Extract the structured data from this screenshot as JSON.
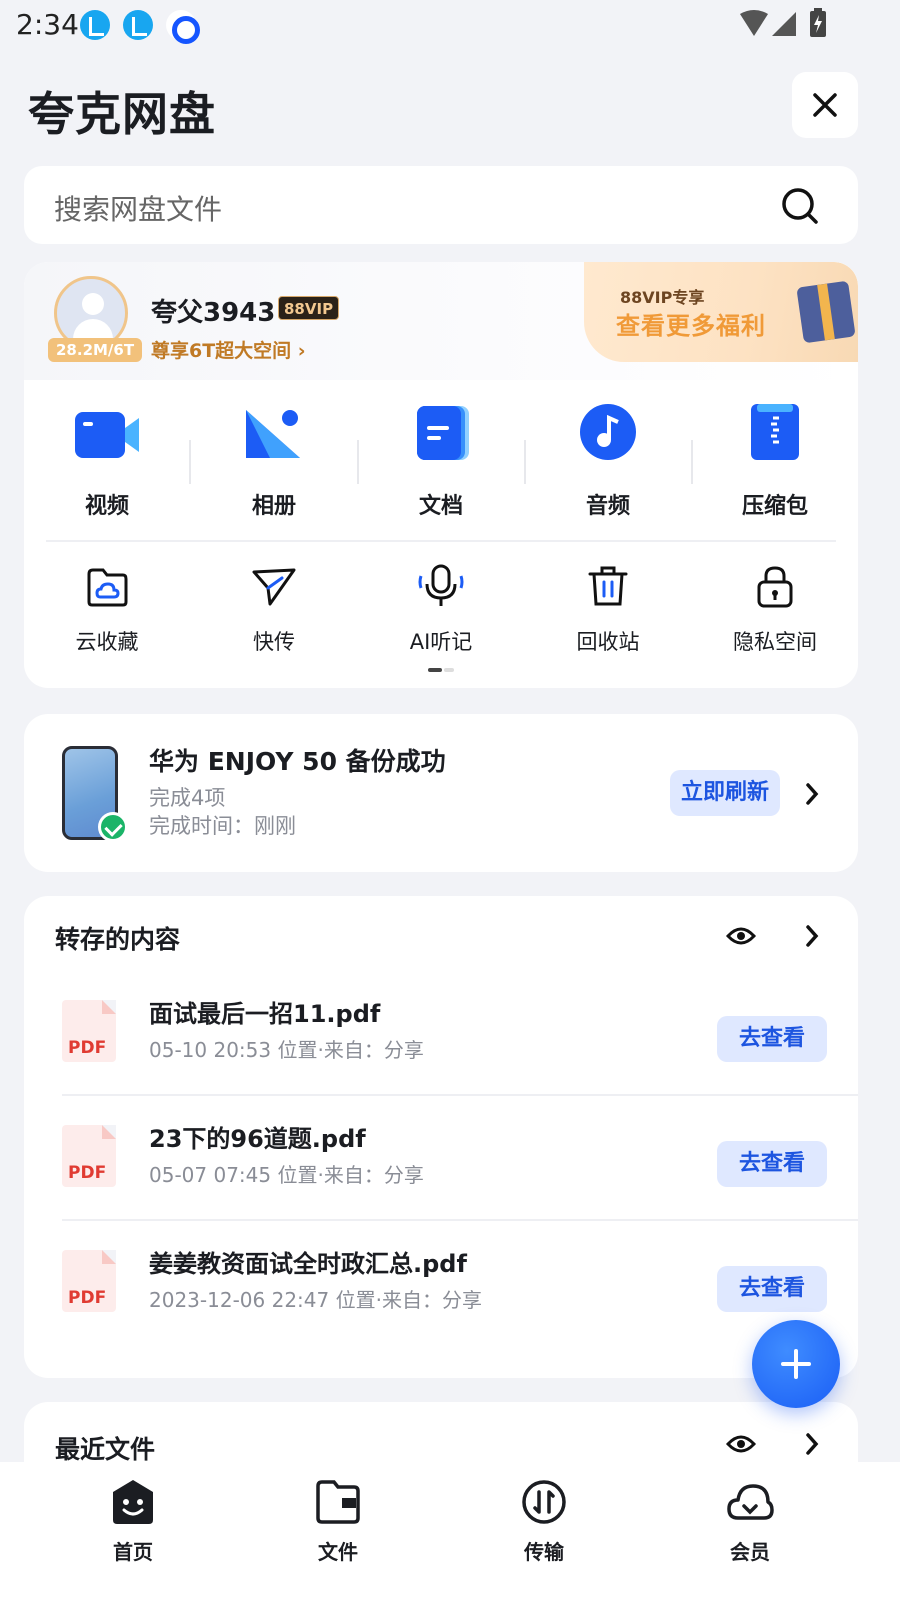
{
  "status_bar": {
    "time": "2:34",
    "icons": [
      "download-icon",
      "download-icon",
      "app-ring-icon",
      "wifi-icon",
      "cell-signal-icon",
      "battery-charging-icon"
    ]
  },
  "header": {
    "title": "夸克网盘",
    "close_icon": "close-icon"
  },
  "search": {
    "placeholder": "搜索网盘文件",
    "icon": "search-icon"
  },
  "profile": {
    "nickname": "夸父3943",
    "vip_badge": "88VIP",
    "storage": "28.2M/6T",
    "upgrade_text": "尊享6T超大空间",
    "promo": {
      "line1": "88VIP专享",
      "line2": "查看更多福利"
    }
  },
  "categories": [
    {
      "label": "视频",
      "icon": "video-icon",
      "color": "#1c5cf5"
    },
    {
      "label": "相册",
      "icon": "album-icon",
      "color": "#1c5cf5"
    },
    {
      "label": "文档",
      "icon": "document-icon",
      "color": "#1c5cf5"
    },
    {
      "label": "音频",
      "icon": "music-icon",
      "color": "#1c5cf5"
    },
    {
      "label": "压缩包",
      "icon": "zip-icon",
      "color": "#1c5cf5"
    }
  ],
  "tools": [
    {
      "label": "云收藏",
      "icon": "cloud-bookmark-icon"
    },
    {
      "label": "快传",
      "icon": "send-icon"
    },
    {
      "label": "AI听记",
      "icon": "microphone-icon"
    },
    {
      "label": "回收站",
      "icon": "trash-icon"
    },
    {
      "label": "隐私空间",
      "icon": "lock-icon"
    }
  ],
  "backup": {
    "title": "华为 ENJOY 50 备份成功",
    "items_done": "完成4项",
    "time": "完成时间：刚刚",
    "refresh_label": "立即刷新"
  },
  "saved_section": {
    "title": "转存的内容",
    "files": [
      {
        "name": "面试最后一招11.pdf",
        "meta": "05-10 20:53 位置·来自：分享",
        "type": "PDF",
        "action": "去查看"
      },
      {
        "name": "23下的96道题.pdf",
        "meta": "05-07 07:45 位置·来自：分享",
        "type": "PDF",
        "action": "去查看"
      },
      {
        "name": "姜姜教资面试全时政汇总.pdf",
        "meta": "2023-12-06 22:47 位置·来自：分享",
        "type": "PDF",
        "action": "去查看"
      }
    ]
  },
  "recent_section": {
    "title": "最近文件"
  },
  "bottom_nav": [
    {
      "label": "首页",
      "icon": "home-icon"
    },
    {
      "label": "文件",
      "icon": "folder-icon"
    },
    {
      "label": "传输",
      "icon": "transfer-icon"
    },
    {
      "label": "会员",
      "icon": "member-cloud-icon"
    }
  ],
  "colors": {
    "accent": "#1c5cf5",
    "background": "#f2f3f7",
    "vip_gold": "#c07a25"
  }
}
